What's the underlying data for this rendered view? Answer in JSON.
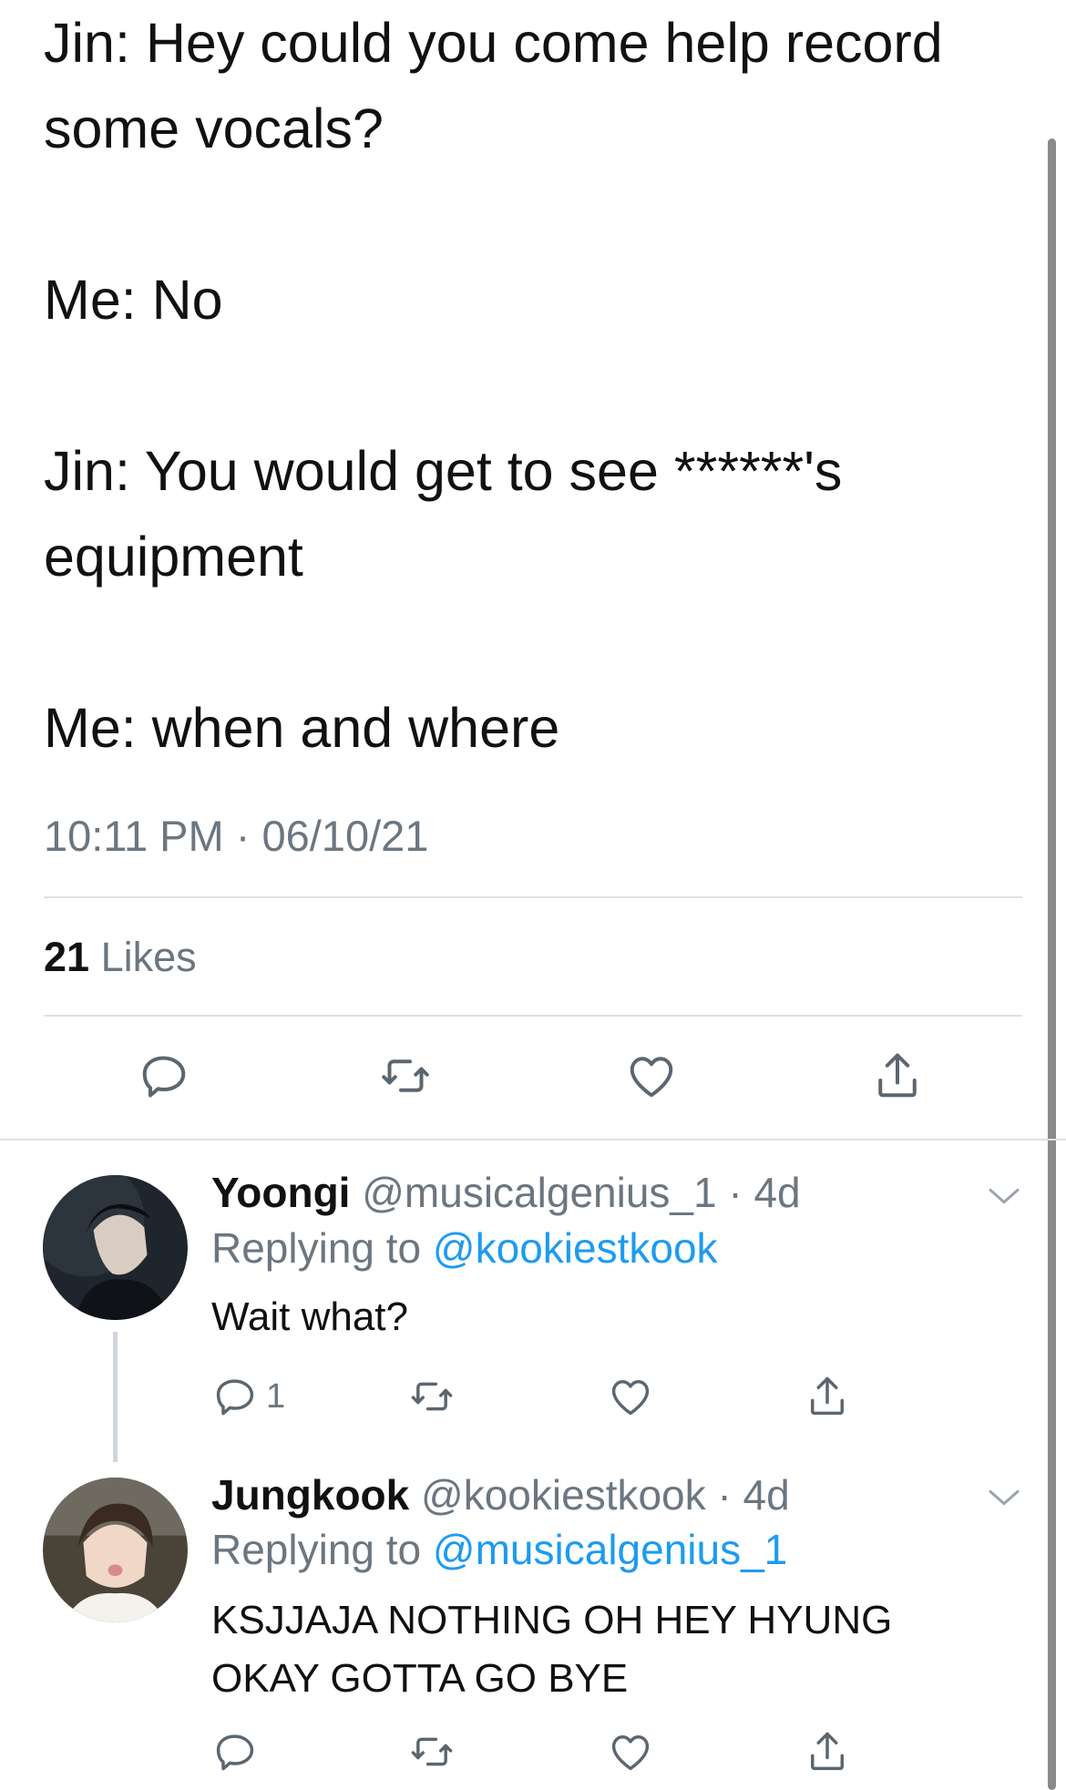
{
  "tweet": {
    "lines": [
      "Jin: Hey could you come help record some vocals?",
      "Me: No",
      "Jin: You would get to see ******'s equipment",
      "Me: when and where"
    ],
    "time": "10:11 PM",
    "separator": "·",
    "date": "06/10/21",
    "likes_count": "21",
    "likes_label": "Likes"
  },
  "replies": [
    {
      "name": "Yoongi",
      "handle": "@musicalgenius_1",
      "separator": "·",
      "age": "4d",
      "replying_label": "Replying to",
      "replying_to": "@kookiestkook",
      "text": "Wait what?",
      "reply_count": "1"
    },
    {
      "name": "Jungkook",
      "handle": "@kookiestkook",
      "separator": "·",
      "age": "4d",
      "replying_label": "Replying to",
      "replying_to": "@musicalgenius_1",
      "text": "KSJJAJA NOTHING OH HEY HYUNG OKAY GOTTA GO BYE",
      "reply_count": ""
    }
  ],
  "icons": {
    "reply": "reply-icon",
    "retweet": "retweet-icon",
    "like": "heart-icon",
    "share": "share-icon",
    "more": "chevron-down-icon"
  },
  "colors": {
    "text": "#0f1419",
    "secondary": "#6b7680",
    "link": "#1d9bf0",
    "divider": "#dde1e5"
  }
}
